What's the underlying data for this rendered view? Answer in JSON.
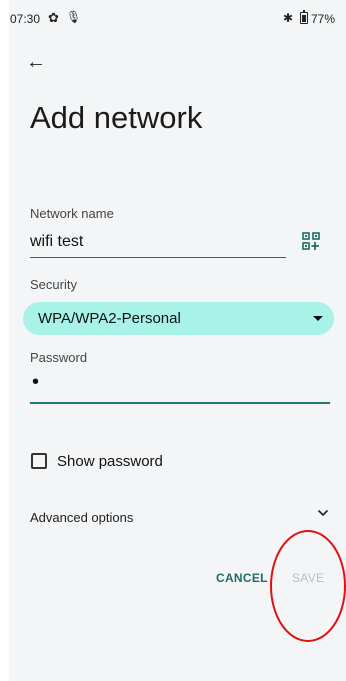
{
  "status_bar": {
    "time": "07:30",
    "battery": "77%"
  },
  "page": {
    "title": "Add network"
  },
  "network_name": {
    "label": "Network name",
    "value": "wifi test"
  },
  "security": {
    "label": "Security",
    "value": "WPA/WPA2-Personal"
  },
  "password": {
    "label": "Password",
    "value": "•"
  },
  "show_password": {
    "label": "Show password",
    "checked": false
  },
  "advanced": {
    "label": "Advanced options"
  },
  "actions": {
    "cancel": "CANCEL",
    "save": "SAVE"
  },
  "colors": {
    "accent": "#1f6e65",
    "dropdown_fill": "#a8f2e7",
    "highlight": "#e01010"
  }
}
